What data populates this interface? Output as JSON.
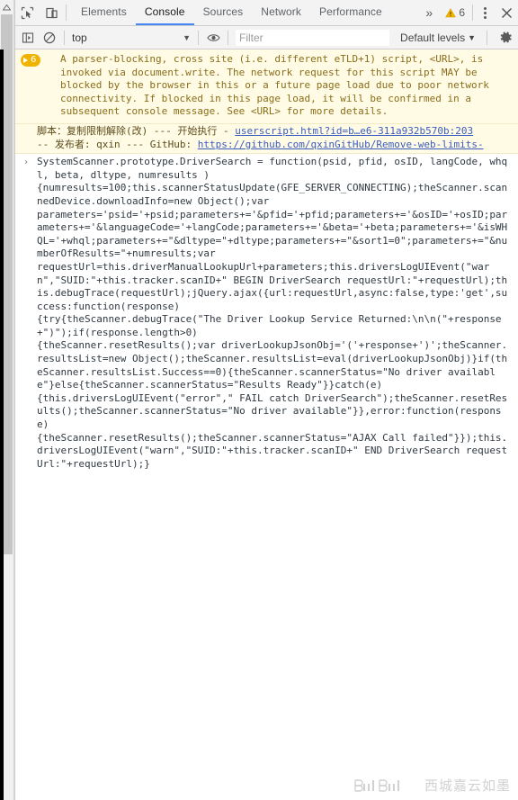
{
  "window": {
    "title": "Chrome DevTools — Console"
  },
  "tabbar": {
    "inspect_icon": "inspect-element-icon",
    "device_icon": "device-toolbar-icon",
    "tabs": [
      {
        "id": "elements",
        "label": "Elements",
        "active": false
      },
      {
        "id": "console",
        "label": "Console",
        "active": true
      },
      {
        "id": "sources",
        "label": "Sources",
        "active": false
      },
      {
        "id": "network",
        "label": "Network",
        "active": false
      },
      {
        "id": "performance",
        "label": "Performance",
        "active": false
      }
    ],
    "more_tabs": "»",
    "warning_count": "6",
    "warning_icon": "warning-triangle-icon",
    "menu_icon": "kebab-menu-icon",
    "close_icon": "close-icon",
    "accent_color": "#4285f4"
  },
  "console_toolbar": {
    "sidebar_toggle_icon": "console-sidebar-icon",
    "clear_icon": "clear-console-icon",
    "context": "top",
    "context_caret": "▼",
    "eye_icon": "live-expression-icon",
    "filter_placeholder": "Filter",
    "filter_value": "",
    "levels_label": "Default levels",
    "levels_caret": "▼",
    "settings_icon": "settings-gear-icon"
  },
  "messages": {
    "violation": {
      "badge_count": "6",
      "badge_icon": "expand-triangle-icon",
      "text": "A parser-blocking, cross site (i.e. different eTLD+1) script, <URL>, is invoked via document.write. The network request for this script MAY be blocked by the browser in this or a future page load due to poor network connectivity. If blocked in this page load, it will be confirmed in a subsequent console message. See <URL> for more details.",
      "bg_color": "#fffbe5",
      "text_color": "#8a6d1a"
    },
    "script_info": {
      "line1_text": "脚本：复制限制解除(改) --- 开始执行 - ",
      "line1_link": "userscript.html?id=b…e6-311a932b570b:203",
      "line2_text": "-- 发布者: qxin --- GitHub: ",
      "line2_link": "https://github.com/qxinGitHub/Remove-web-limits-"
    },
    "code_message": {
      "expand_arrow": "›",
      "lines": [
        "SystemScanner.prototype.DriverSearch = function(psid, pfid, osID, langCode, whql, beta, dltype, numresults )",
        "{numresults=100;this.scannerStatusUpdate(GFE_SERVER_CONNECTING);theScanner.scannedDevice.downloadInfo=new Object();var",
        "parameters='psid='+psid;parameters+='&pfid='+pfid;parameters+='&osID='+osID;parameters+='&languageCode='+langCode;parameters+='&beta='+beta;parameters+='&isWHQL='+whql;parameters+=\"&dltype=\"+dltype;parameters+=\"&sort1=0\";parameters+=\"&numberOfResults=\"+numresults;var",
        "requestUrl=this.driverManualLookupUrl+parameters;this.driversLogUIEvent(\"warn\",\"SUID:\"+this.tracker.scanID+\" BEGIN DriverSearch requestUrl:\"+requestUrl);this.debugTrace(requestUrl);jQuery.ajax({url:requestUrl,async:false,type:'get',success:function(response)",
        "{try{theScanner.debugTrace(\"The Driver Lookup Service Returned:\\n\\n(\"+response+\")\");if(response.length>0)",
        "{theScanner.resetResults();var driverLookupJsonObj='('+response+')';theScanner.resultsList=new Object();theScanner.resultsList=eval(driverLookupJsonObj)}if(theScanner.resultsList.Success==0){theScanner.scannerStatus=\"No driver available\"}else{theScanner.scannerStatus=\"Results Ready\"}}catch(e)",
        "{this.driversLogUIEvent(\"error\",\" FAIL catch DriverSearch\");theScanner.resetResults();theScanner.scannerStatus=\"No driver available\"}},error:function(response)",
        "{theScanner.resetResults();theScanner.scannerStatus=\"AJAX Call failed\"}});this.driversLogUIEvent(\"warn\",\"SUID:\"+this.tracker.scanID+\" END DriverSearch requestUrl:\"+requestUrl);}"
      ]
    }
  },
  "watermark": {
    "logo": "bilibili-logo",
    "text": "西城嘉云如墨"
  }
}
